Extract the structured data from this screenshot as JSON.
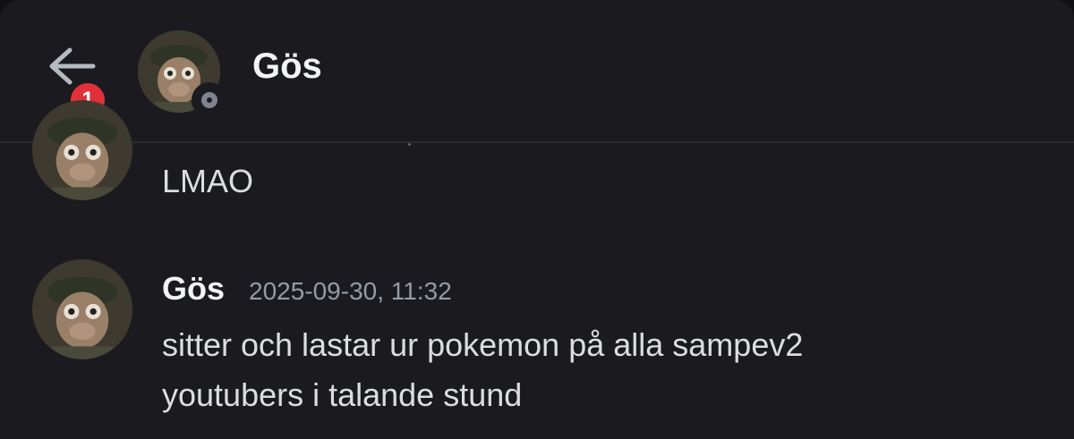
{
  "header": {
    "title": "Gös",
    "back_badge": "1"
  },
  "messages": [
    {
      "text": "LMAO"
    },
    {
      "author": "Gös",
      "timestamp": "2025-09-30, 11:32",
      "lines": [
        "sitter och lastar ur pokemon på alla sampev2",
        "youtubers i talande stund"
      ]
    }
  ],
  "colors": {
    "background": "#1b1b1f",
    "badge": "#e0313b",
    "status_offline": "#80848e",
    "timestamp": "#949ba4"
  },
  "icons": [
    "arrow-left-icon",
    "offline-status-icon"
  ]
}
